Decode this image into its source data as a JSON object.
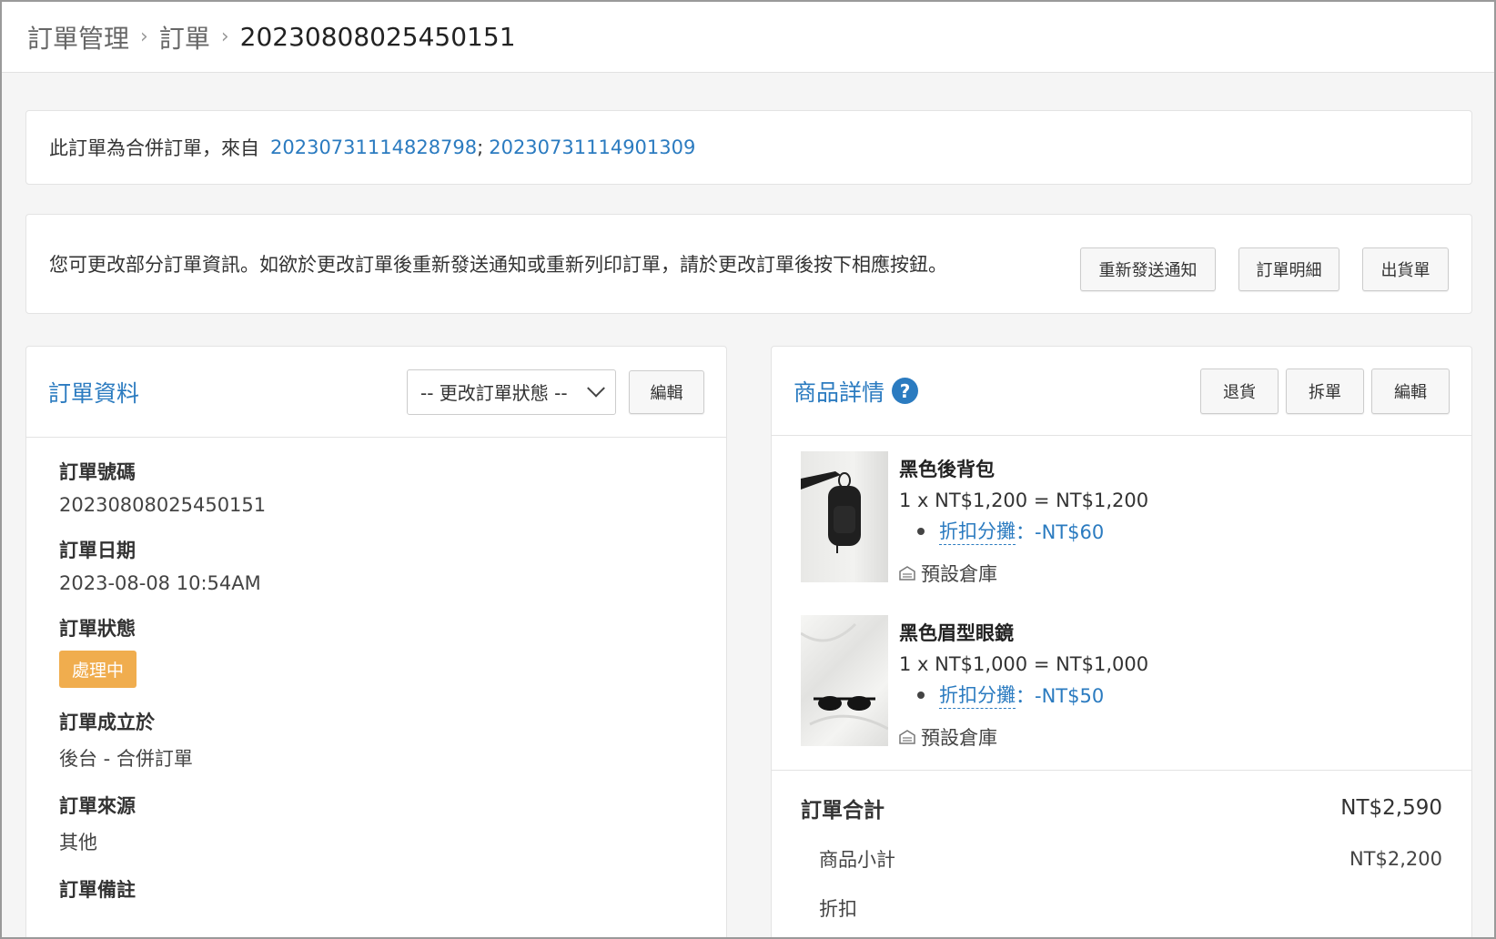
{
  "breadcrumb": {
    "items": [
      "訂單管理",
      "訂單",
      "20230808025450151"
    ],
    "separator": ">"
  },
  "merge_notice": {
    "text": "此訂單為合併訂單，來自",
    "links": [
      "20230731114828798",
      "20230731114901309"
    ],
    "link_separator": ";"
  },
  "edit_notice": {
    "text": "您可更改部分訂單資訊。如欲於更改訂單後重新發送通知或重新列印訂單，請於更改訂單後按下相應按鈕。",
    "buttons": [
      "重新發送通知",
      "訂單明細",
      "出貨單"
    ]
  },
  "order_info": {
    "title": "訂單資料",
    "status_select": "-- 更改訂單狀態 --",
    "edit_button": "編輯",
    "fields": [
      {
        "label": "訂單號碼",
        "value": "20230808025450151"
      },
      {
        "label": "訂單日期",
        "value": "2023-08-08 10:54AM"
      },
      {
        "label": "訂單狀態",
        "value": "處理中"
      },
      {
        "label": "訂單成立於",
        "value": "後台 - 合併訂單"
      },
      {
        "label": "訂單來源",
        "value": "其他"
      },
      {
        "label": "訂單備註",
        "value": ""
      }
    ],
    "status_color": "#f0ad4e"
  },
  "product_details": {
    "title": "商品詳情",
    "buttons": [
      "退貨",
      "拆單",
      "編輯"
    ],
    "items": [
      {
        "name": "黑色後背包",
        "calc": "1 x NT$1,200 = NT$1,200",
        "discount_label": "折扣分攤",
        "discount_value": "：-NT$60",
        "warehouse": "預設倉庫"
      },
      {
        "name": "黑色眉型眼鏡",
        "calc": "1 x NT$1,000 = NT$1,000",
        "discount_label": "折扣分攤",
        "discount_value": "：-NT$50",
        "warehouse": "預設倉庫"
      }
    ],
    "totals": {
      "total_label": "訂單合計",
      "total_value": "NT$2,590",
      "subtotal_label": "商品小計",
      "subtotal_value": "NT$2,200",
      "discount_label": "折扣"
    }
  },
  "colors": {
    "link": "#2b7bc0",
    "badge": "#f0ad4e"
  }
}
